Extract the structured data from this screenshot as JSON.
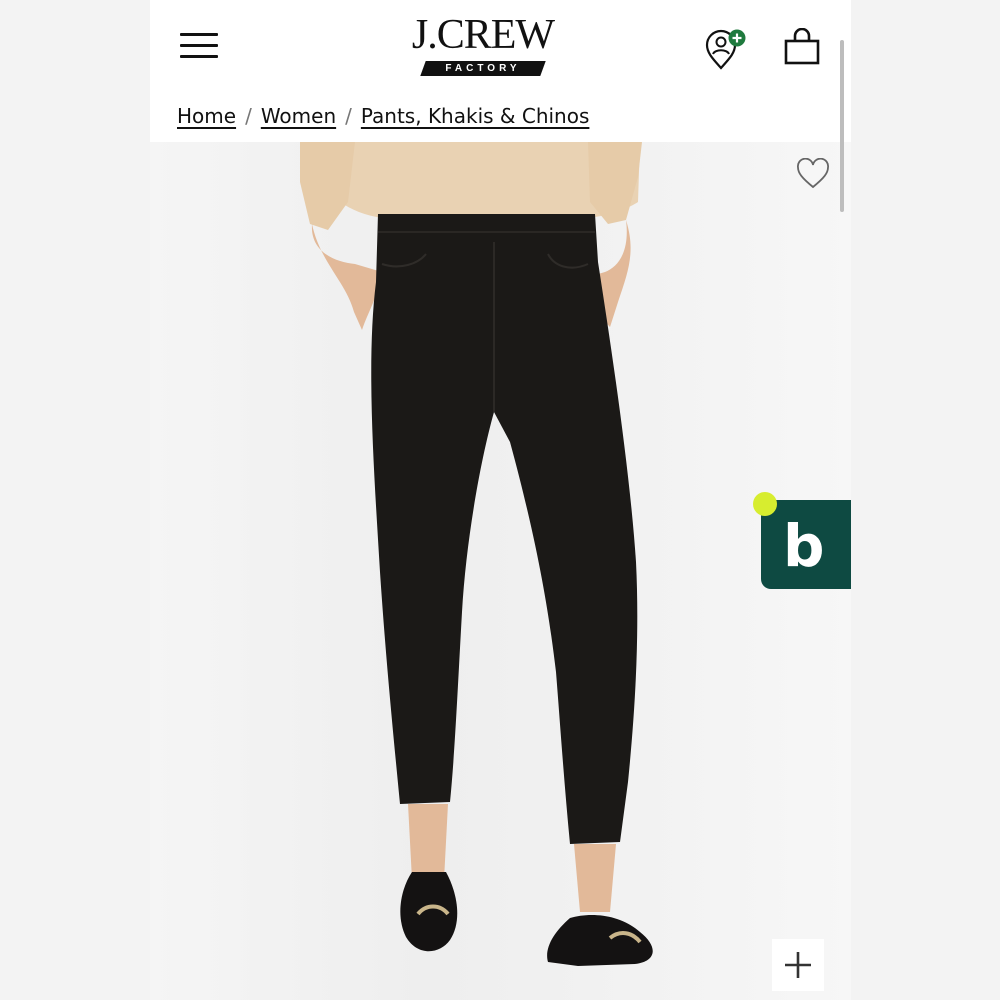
{
  "header": {
    "logo_text": "J.CREW",
    "logo_subtext": "FACTORY"
  },
  "breadcrumb": {
    "items": [
      "Home",
      "Women",
      "Pants, Khakis & Chinos"
    ],
    "separator": "/"
  },
  "icons": {
    "menu": "menu-icon",
    "account": "account-icon",
    "bag": "shopping-bag-icon",
    "wishlist": "heart-icon",
    "zoom": "plus-icon"
  },
  "badge_widget": {
    "letter": "b",
    "background": "#0e4a42",
    "dot_color": "#d7ed2f"
  },
  "colors": {
    "account_badge": "#1f7a3e"
  }
}
